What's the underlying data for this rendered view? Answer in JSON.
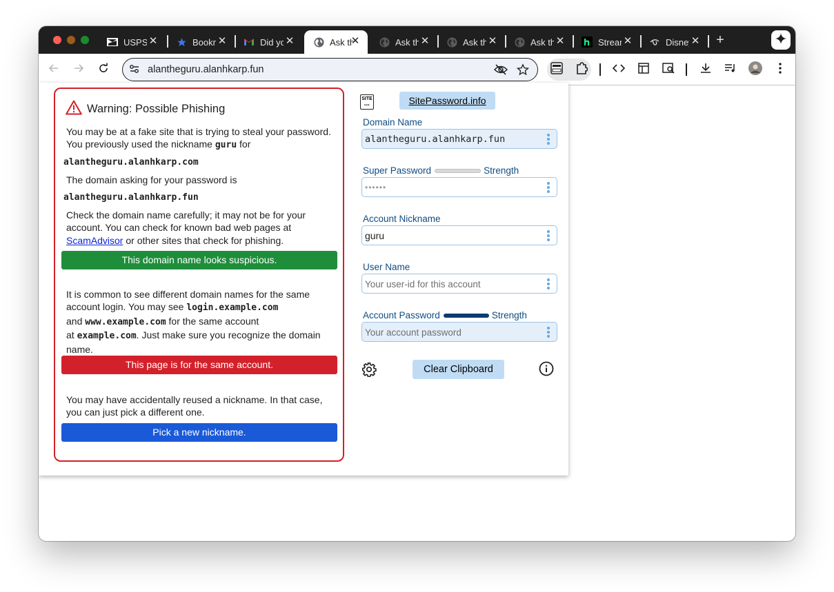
{
  "tabs": [
    {
      "title": "USPS",
      "icon": "usps-icon"
    },
    {
      "title": "Bookmarks",
      "icon": "bookmark-star-icon"
    },
    {
      "title": "Did you",
      "icon": "gmail-icon"
    },
    {
      "title": "Ask the",
      "icon": "globe-icon",
      "active": true
    },
    {
      "title": "Ask the",
      "icon": "globe-icon"
    },
    {
      "title": "Ask the",
      "icon": "globe-icon"
    },
    {
      "title": "Ask the",
      "icon": "globe-icon"
    },
    {
      "title": "Stream",
      "icon": "hulu-icon"
    },
    {
      "title": "Disney",
      "icon": "disney-icon"
    }
  ],
  "tab_close_glyph": "✕",
  "new_tab_glyph": "+",
  "address_bar": {
    "url": "alantheguru.alanhkarp.fun"
  },
  "warning": {
    "title": "Warning: Possible Phishing",
    "p1_before": "You may be at a fake site that is trying to steal your password. You previously used the nickname ",
    "p1_nickname": "guru",
    "p1_after": " for",
    "previous_domain": "alantheguru.alanhkarp.com",
    "p2": "The domain asking for your password is",
    "current_domain": "alantheguru.alanhkarp.fun",
    "p3_before": "Check the domain name carefully; it may not be for your account. You can check for known bad web pages at ",
    "p3_link": "ScamAdvisor",
    "p3_after": " or other sites that check for phishing.",
    "btn_suspicious": "This domain name looks suspicious.",
    "p4_a": "It is common to see different domain names for the same account login. You may see ",
    "p4_code1": "login.example.com",
    "p4_b": "and ",
    "p4_code2": "www.example.com",
    "p4_c": " for the same account",
    "p4_d": "at ",
    "p4_code3": "example.com",
    "p4_e": ". Just make sure you recognize the domain name.",
    "btn_same_account": "This page is for the same account.",
    "p5": "You may have accidentally reused a nickname. In that case, you can just pick a different one.",
    "btn_new_nickname": "Pick a new nickname."
  },
  "sitepassword": {
    "logo_text": "SITE",
    "link": "SitePassword.info",
    "domain_label": "Domain Name",
    "domain_value": "alantheguru.alanhkarp.fun",
    "super_label": "Super Password",
    "super_strength_label": "Strength",
    "super_value": "••••••",
    "nickname_label": "Account Nickname",
    "nickname_value": "guru",
    "username_label": "User Name",
    "username_placeholder": "Your user-id for this account",
    "acctpw_label": "Account Password",
    "acctpw_strength_label": "Strength",
    "acctpw_placeholder": "Your account password",
    "clear_button": "Clear Clipboard",
    "super_strength_level": 0,
    "account_strength_level": 1
  },
  "colors": {
    "warning_border": "#d32027",
    "suspicious_btn": "#1f8e3b",
    "same_account_btn": "#d3212b",
    "new_nickname_btn": "#1a5ad8",
    "field_label": "#0f4c81",
    "field_border": "#9bc3e6",
    "accent_button": "#c0dcf5",
    "strong_meter": "#0d3b73",
    "empty_meter": "#d9d9d9"
  }
}
